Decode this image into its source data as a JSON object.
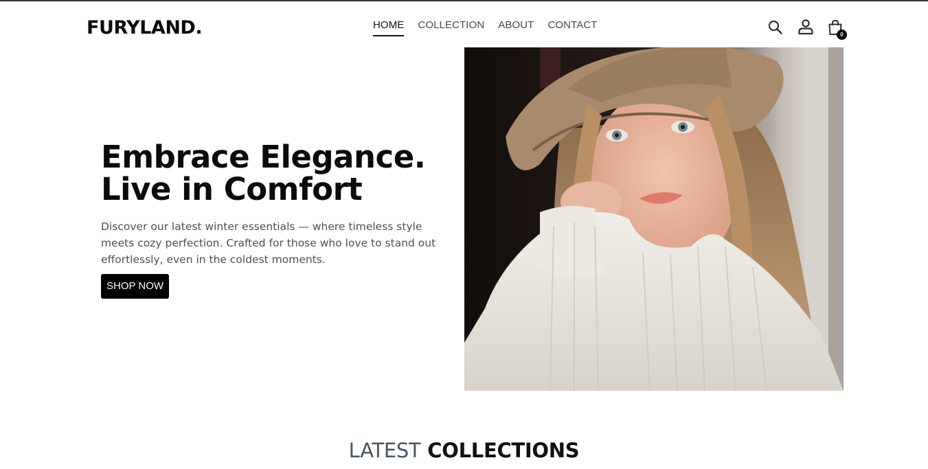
{
  "brand": {
    "logo_text": "FURYLAND."
  },
  "nav": {
    "items": [
      {
        "label": "HOME",
        "active": true
      },
      {
        "label": "COLLECTION",
        "active": false
      },
      {
        "label": "ABOUT",
        "active": false
      },
      {
        "label": "CONTACT",
        "active": false
      }
    ]
  },
  "header_icons": {
    "search": "search-icon",
    "profile": "user-icon",
    "cart": "shopping-bag-icon",
    "cart_count": "0"
  },
  "hero": {
    "title_line1": "Embrace Elegance.",
    "title_line2": "Live in Comfort",
    "description": "Discover our latest winter essentials — where timeless style meets cozy perfection. Crafted for those who love to stand out effortlessly, even in the coldest moments.",
    "cta_label": "SHOP NOW"
  },
  "latest": {
    "title_light": "LATEST",
    "title_bold": "COLLECTIONS"
  },
  "colors": {
    "accent": "#000000",
    "text_muted": "#4a4f5a",
    "nav_text": "#3f4754"
  }
}
